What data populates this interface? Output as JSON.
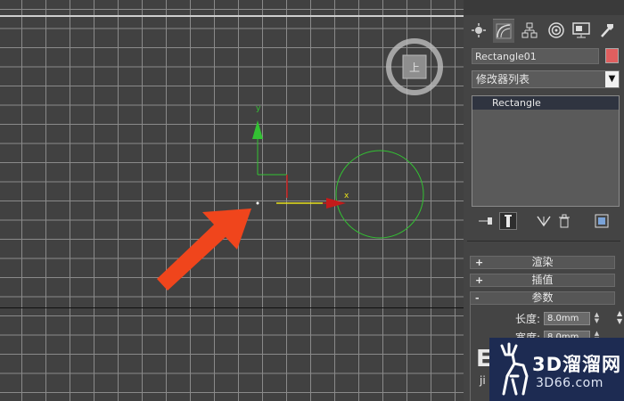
{
  "viewport": {
    "viewcube_face_label": "上",
    "gizmo_y_label": "y",
    "gizmo_x_label": "x",
    "colors": {
      "grid_line": "#8a8a8a",
      "grid_bg": "#414141",
      "circle": "#33c233",
      "arrow": "#f0451c"
    }
  },
  "command_panel": {
    "tabs": [
      {
        "name": "create-tab",
        "icon": "sun-icon"
      },
      {
        "name": "modify-tab",
        "icon": "modify-curve-icon"
      },
      {
        "name": "hierarchy-tab",
        "icon": "hierarchy-icon"
      },
      {
        "name": "motion-tab",
        "icon": "motion-disc-icon"
      },
      {
        "name": "display-tab",
        "icon": "monitor-icon"
      },
      {
        "name": "utilities-tab",
        "icon": "hammer-icon"
      }
    ],
    "object_name": "Rectangle01",
    "object_color": "#e05f5f",
    "modifier_list_label": "修改器列表",
    "modifier_stack": [
      "Rectangle"
    ],
    "stack_tools": [
      "pin-stack-icon",
      "show-end-result-icon",
      "make-unique-icon",
      "remove-modifier-icon",
      "configure-modifier-sets-icon"
    ],
    "rollouts": [
      {
        "sign": "+",
        "title": "渲染"
      },
      {
        "sign": "+",
        "title": "插值"
      },
      {
        "sign": "-",
        "title": "参数"
      }
    ],
    "params": [
      {
        "label": "长度:",
        "value": "8.0mm"
      },
      {
        "label": "宽度:",
        "value": "8.0mm"
      }
    ]
  },
  "watermark": {
    "brand_cn": "3D溜溜网",
    "brand_url": "3D66.com",
    "behind_text_1": "E",
    "behind_text_2": "ji"
  }
}
